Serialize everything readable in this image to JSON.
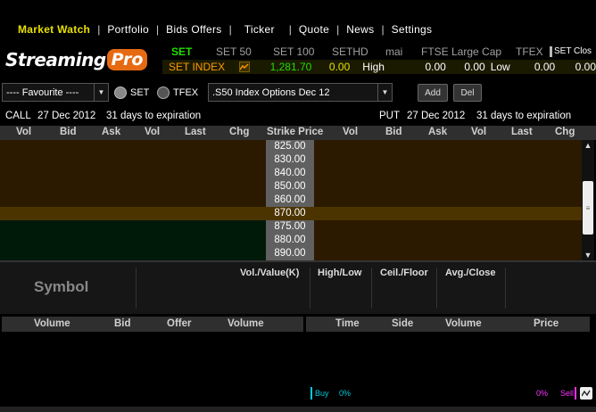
{
  "menu": {
    "items": [
      {
        "label": "Market Watch",
        "active": true
      },
      {
        "label": "Portfolio"
      },
      {
        "label": "Bids Offers"
      },
      {
        "label": "Ticker"
      },
      {
        "label": "Quote"
      },
      {
        "label": "News"
      },
      {
        "label": "Settings"
      }
    ]
  },
  "logo": {
    "streaming": "Streaming",
    "pro": "Pro"
  },
  "index_tabs": [
    "SET",
    "SET 50",
    "SET 100",
    "SETHD",
    "mai",
    "FTSE Large Cap",
    "TFEX"
  ],
  "index_status": "SET Clos",
  "index_row": {
    "name": "SET INDEX",
    "value": "1,281.70",
    "change": "0.00",
    "high_label": "High",
    "high_1": "0.00",
    "high_2": "0.00",
    "low_label": "Low",
    "low_1": "0.00",
    "low_2": "0.00"
  },
  "controls": {
    "favourite": "---- Favourite ----",
    "radio_set": "SET",
    "radio_tfex": "TFEX",
    "series": ".S50 Index Options Dec 12",
    "add": "Add",
    "del": "Del"
  },
  "expiration": {
    "call_label": "CALL",
    "call_date": "27 Dec 2012",
    "call_days": "31 days to expiration",
    "put_label": "PUT",
    "put_date": "27 Dec 2012",
    "put_days": "31 days to expiration"
  },
  "option_headers": [
    "Vol",
    "Bid",
    "Ask",
    "Vol",
    "Last",
    "Chg",
    "Strike Price",
    "Vol",
    "Bid",
    "Ask",
    "Vol",
    "Last",
    "Chg"
  ],
  "strikes": [
    {
      "price": "825.00",
      "zone": "itm"
    },
    {
      "price": "830.00",
      "zone": "itm"
    },
    {
      "price": "840.00",
      "zone": "itm"
    },
    {
      "price": "850.00",
      "zone": "itm"
    },
    {
      "price": "860.00",
      "zone": "itm"
    },
    {
      "price": "870.00",
      "zone": "atm"
    },
    {
      "price": "875.00",
      "zone": "otm"
    },
    {
      "price": "880.00",
      "zone": "otm"
    },
    {
      "price": "890.00",
      "zone": "otm"
    }
  ],
  "quote_panel": {
    "symbol": "Symbol",
    "headers": [
      "Vol./Value(K)",
      "High/Low",
      "Ceil./Floor",
      "Avg./Close"
    ]
  },
  "depth_headers_left": [
    "Volume",
    "Bid",
    "Offer",
    "Volume"
  ],
  "depth_headers_right": [
    "Time",
    "Side",
    "Volume",
    "Price"
  ],
  "buy_sell": {
    "buy_label": "Buy",
    "buy_pct": "0%",
    "sell_pct": "0%",
    "sell_label": "Sell"
  },
  "colors": {
    "itm_bg": "#2b1a00",
    "atm_bg": "#4c3400",
    "otm_bg": "#001a0a",
    "menu_active": "#e8e000",
    "index_value": "#22dd00",
    "index_change": "#e8e000",
    "set_tab": "#22dd00",
    "index_name": "#ff9900"
  }
}
